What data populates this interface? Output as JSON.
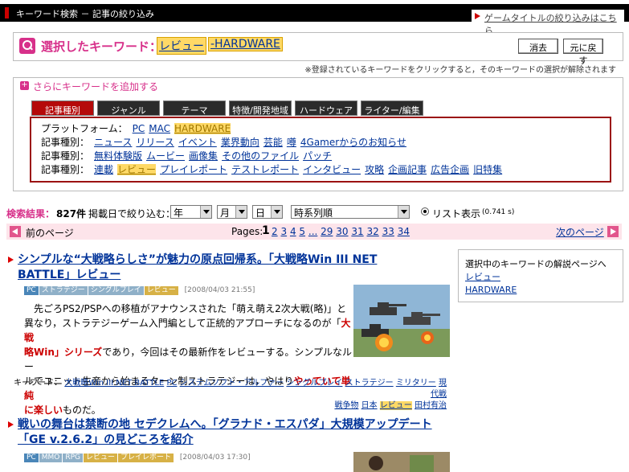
{
  "topbar": {
    "title": "キーワード検索 － 記事の絞り込み",
    "link": "ゲームタイトルの絞り込みはこちら"
  },
  "selected": {
    "label": "選択したキーワード：",
    "keywords": [
      "レビュー",
      "-HARDWARE"
    ],
    "clear_button": "消去",
    "restore_button": "元に戻す",
    "note": "※登録されているキーワードをクリックすると，そのキーワードの選択が解除されます"
  },
  "add": {
    "label": "さらにキーワードを追加する",
    "tabs": [
      "記事種別",
      "ジャンル",
      "テーマ",
      "特徴/開発地域",
      "ハードウェア",
      "ライター/編集者"
    ],
    "rows": [
      {
        "head": "プラットフォーム：",
        "items": [
          "PC",
          "MAC",
          "HARDWARE"
        ]
      },
      {
        "head": "記事種別：",
        "items": [
          "ニュース",
          "リリース",
          "イベント",
          "業界動向",
          "芸能",
          "噂",
          "4Gamerからのお知らせ"
        ]
      },
      {
        "head": "記事種別：",
        "items": [
          "無料体験版",
          "ムービー",
          "画像集",
          "その他のファイル",
          "パッチ"
        ]
      },
      {
        "head": "記事種別：",
        "items": [
          "連載",
          "レビュー",
          "プレイレポート",
          "テストレポート",
          "インタビュー",
          "攻略",
          "企画記事",
          "広告企画",
          "旧特集"
        ]
      }
    ]
  },
  "results": {
    "label": "検索結果：",
    "count": "827件",
    "filter_label": "掲載日で絞り込む：",
    "year": "年",
    "month": "月",
    "day": "日",
    "order": "時系列順",
    "list_view": "リスト表示",
    "time": "(0.741 s)"
  },
  "pager": {
    "prev": "前のページ",
    "pages_label": "Pages:",
    "current": "1",
    "pages": [
      "2",
      "3",
      "4",
      "5",
      "...",
      "29",
      "30",
      "31",
      "32",
      "33",
      "34"
    ],
    "next": "次のページ"
  },
  "sidebox": {
    "title": "選択中のキーワードの解説ページへ",
    "links": [
      "レビュー",
      "HARDWARE"
    ]
  },
  "articles": [
    {
      "title_l1": "シンプルな“大戦略らしさ”が魅力の原点回帰系。「大戦略Win III NET",
      "title_l2": "BATTLE」レビュー",
      "tags": [
        "PC",
        "ストラテジー",
        "シングルプレイ",
        "レビュー"
      ],
      "date": "[2008/04/03 21:55]",
      "body_l1": "先ごろPS2/PSPへの移植がアナウンスされた「萌え萌え2次大戦(略)」と",
      "body_l2": "異なり，ストラテジーゲーム入門編として正統的アプローチになるのが「",
      "body_l2b": "大戦",
      "body_l3a": "略Win」シリーズ",
      "body_l3": "であり，今回はその最新作をレビューする。シンプルなルー",
      "body_l4": "ルでユニット生産から始まるターン制ストラテジーは，やはり",
      "body_l4b": "やっていて単純",
      "body_l5a": "に楽しい",
      "body_l5": "ものだ。",
      "kw_label": "キーワード：",
      "kw_line1": [
        "大戦略Win III NET BATTLE",
        "PC",
        "システムソフト・アルファー",
        "シングルプレイ",
        "ストラテジー",
        "ミリタリー",
        "現代戦"
      ],
      "kw_line2": [
        "戦争物",
        "日本",
        "レビュー",
        "田村有治"
      ]
    },
    {
      "title_l1": "戦いの舞台は禁断の地 セデクレムへ。「グラナド・エスパダ」大規模アップデート",
      "title_l2": "「GE v.2.6.2」の見どころを紹介",
      "tags": [
        "PC",
        "MMO",
        "RPG",
        "レビュー",
        "プレイレポート"
      ],
      "date": "[2008/04/03 17:30]"
    }
  ]
}
